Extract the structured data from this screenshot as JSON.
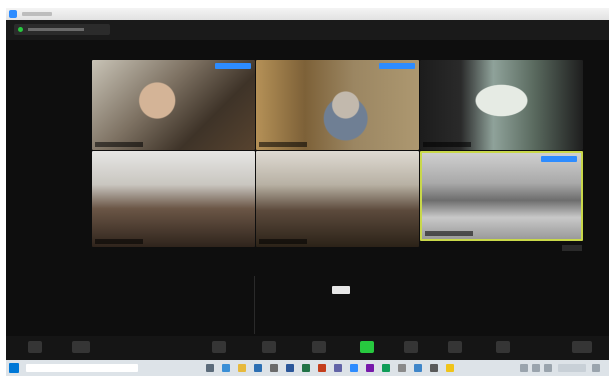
{
  "colors": {
    "accent": "#2d8cff",
    "active_speaker_border": "#c9d84a",
    "highlight_green": "#27c93f",
    "meeting_background": "#121212",
    "taskbar_background": "#dde3e8"
  },
  "video_tiles": [
    {
      "label": "",
      "muted_badge": true
    },
    {
      "label": "",
      "muted_badge": true
    },
    {
      "label": "",
      "muted_badge": false
    },
    {
      "label": "",
      "muted_badge": false
    },
    {
      "label": "",
      "muted_badge": false
    },
    {
      "label": "",
      "muted_badge": true,
      "active_speaker": true
    }
  ],
  "icons": {
    "app": "zoom-icon",
    "start": "windows-start-icon",
    "active_control": "share-screen-icon"
  }
}
